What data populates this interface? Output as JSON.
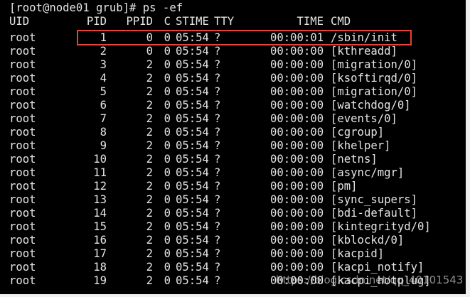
{
  "terminal": {
    "prompt_line": "[root@node01 grub]# ps -ef",
    "headers": {
      "uid": "UID",
      "pid": "PID",
      "ppid": "PPID",
      "c": "C",
      "stime": "STIME",
      "tty": "TTY",
      "time": "TIME",
      "cmd": "CMD"
    },
    "rows": [
      {
        "uid": "root",
        "pid": "1",
        "ppid": "0",
        "c": "0",
        "stime": "05:54",
        "tty": "?",
        "time": "00:00:01",
        "cmd": "/sbin/init"
      },
      {
        "uid": "root",
        "pid": "2",
        "ppid": "0",
        "c": "0",
        "stime": "05:54",
        "tty": "?",
        "time": "00:00:00",
        "cmd": "[kthreadd]"
      },
      {
        "uid": "root",
        "pid": "3",
        "ppid": "2",
        "c": "0",
        "stime": "05:54",
        "tty": "?",
        "time": "00:00:00",
        "cmd": "[migration/0]"
      },
      {
        "uid": "root",
        "pid": "4",
        "ppid": "2",
        "c": "0",
        "stime": "05:54",
        "tty": "?",
        "time": "00:00:00",
        "cmd": "[ksoftirqd/0]"
      },
      {
        "uid": "root",
        "pid": "5",
        "ppid": "2",
        "c": "0",
        "stime": "05:54",
        "tty": "?",
        "time": "00:00:00",
        "cmd": "[migration/0]"
      },
      {
        "uid": "root",
        "pid": "6",
        "ppid": "2",
        "c": "0",
        "stime": "05:54",
        "tty": "?",
        "time": "00:00:00",
        "cmd": "[watchdog/0]"
      },
      {
        "uid": "root",
        "pid": "7",
        "ppid": "2",
        "c": "0",
        "stime": "05:54",
        "tty": "?",
        "time": "00:00:00",
        "cmd": "[events/0]"
      },
      {
        "uid": "root",
        "pid": "8",
        "ppid": "2",
        "c": "0",
        "stime": "05:54",
        "tty": "?",
        "time": "00:00:00",
        "cmd": "[cgroup]"
      },
      {
        "uid": "root",
        "pid": "9",
        "ppid": "2",
        "c": "0",
        "stime": "05:54",
        "tty": "?",
        "time": "00:00:00",
        "cmd": "[khelper]"
      },
      {
        "uid": "root",
        "pid": "10",
        "ppid": "2",
        "c": "0",
        "stime": "05:54",
        "tty": "?",
        "time": "00:00:00",
        "cmd": "[netns]"
      },
      {
        "uid": "root",
        "pid": "11",
        "ppid": "2",
        "c": "0",
        "stime": "05:54",
        "tty": "?",
        "time": "00:00:00",
        "cmd": "[async/mgr]"
      },
      {
        "uid": "root",
        "pid": "12",
        "ppid": "2",
        "c": "0",
        "stime": "05:54",
        "tty": "?",
        "time": "00:00:00",
        "cmd": "[pm]"
      },
      {
        "uid": "root",
        "pid": "13",
        "ppid": "2",
        "c": "0",
        "stime": "05:54",
        "tty": "?",
        "time": "00:00:00",
        "cmd": "[sync_supers]"
      },
      {
        "uid": "root",
        "pid": "14",
        "ppid": "2",
        "c": "0",
        "stime": "05:54",
        "tty": "?",
        "time": "00:00:00",
        "cmd": "[bdi-default]"
      },
      {
        "uid": "root",
        "pid": "15",
        "ppid": "2",
        "c": "0",
        "stime": "05:54",
        "tty": "?",
        "time": "00:00:00",
        "cmd": "[kintegrityd/0]"
      },
      {
        "uid": "root",
        "pid": "16",
        "ppid": "2",
        "c": "0",
        "stime": "05:54",
        "tty": "?",
        "time": "00:00:00",
        "cmd": "[kblockd/0]"
      },
      {
        "uid": "root",
        "pid": "17",
        "ppid": "2",
        "c": "0",
        "stime": "05:54",
        "tty": "?",
        "time": "00:00:00",
        "cmd": "[kacpid]"
      },
      {
        "uid": "root",
        "pid": "18",
        "ppid": "2",
        "c": "0",
        "stime": "05:54",
        "tty": "?",
        "time": "00:00:00",
        "cmd": "[kacpi_notify]"
      },
      {
        "uid": "root",
        "pid": "19",
        "ppid": "2",
        "c": "0",
        "stime": "05:54",
        "tty": "?",
        "time": "00:00:00",
        "cmd": "[kacpi_hotplug]"
      }
    ],
    "highlighted_pid": "1",
    "highlight_color": "#e8413a",
    "text_color": "#e4e4e4",
    "background_color": "#000000"
  },
  "watermark": "https://blog.csdn.net/qq_40101543"
}
